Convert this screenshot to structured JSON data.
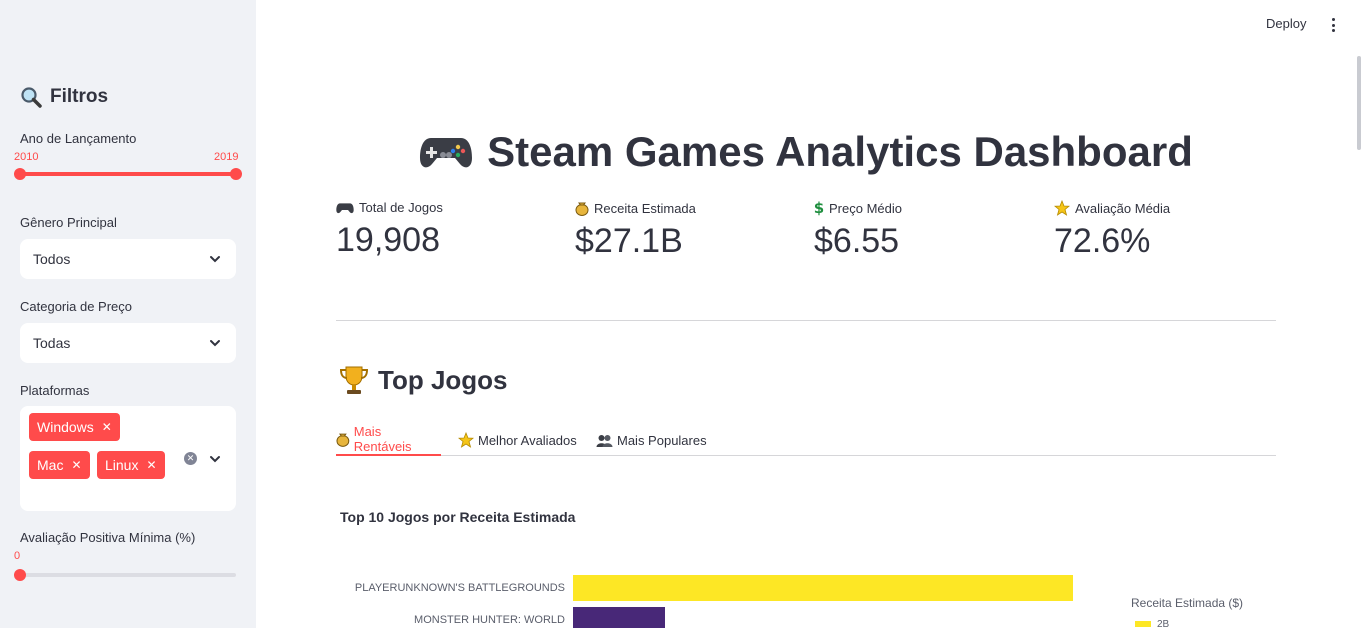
{
  "header": {
    "deploy_label": "Deploy"
  },
  "sidebar": {
    "title": "Filtros",
    "year": {
      "label": "Ano de Lançamento",
      "min_value": "2010",
      "max_value": "2019"
    },
    "genre": {
      "label": "Gênero Principal",
      "value": "Todos"
    },
    "price": {
      "label": "Categoria de Preço",
      "value": "Todas"
    },
    "platforms": {
      "label": "Plataformas",
      "chips": [
        "Windows",
        "Mac",
        "Linux"
      ]
    },
    "rating": {
      "label": "Avaliação Positiva Mínima (%)",
      "value": "0"
    }
  },
  "main": {
    "title": "Steam Games Analytics Dashboard",
    "metrics": [
      {
        "label": "Total de Jogos",
        "value": "19,908"
      },
      {
        "label": "Receita Estimada",
        "value": "$27.1B"
      },
      {
        "label": "Preço Médio",
        "value": "$6.55"
      },
      {
        "label": "Avaliação Média",
        "value": "72.6%"
      }
    ],
    "section_title": "Top Jogos",
    "tabs": [
      "Mais Rentáveis",
      "Melhor Avaliados",
      "Mais Populares"
    ],
    "chart_title": "Top 10 Jogos por Receita Estimada"
  },
  "chart_data": {
    "type": "bar",
    "orientation": "horizontal",
    "title": "Top 10 Jogos por Receita Estimada",
    "categories": [
      "PLAYERUNKNOWN'S BATTLEGROUNDS",
      "MONSTER HUNTER: WORLD"
    ],
    "values": [
      5.0,
      0.92
    ],
    "colors": [
      "#fde725",
      "#482878"
    ],
    "legend_title": "Receita Estimada ($)",
    "legend_tick": "2B"
  }
}
